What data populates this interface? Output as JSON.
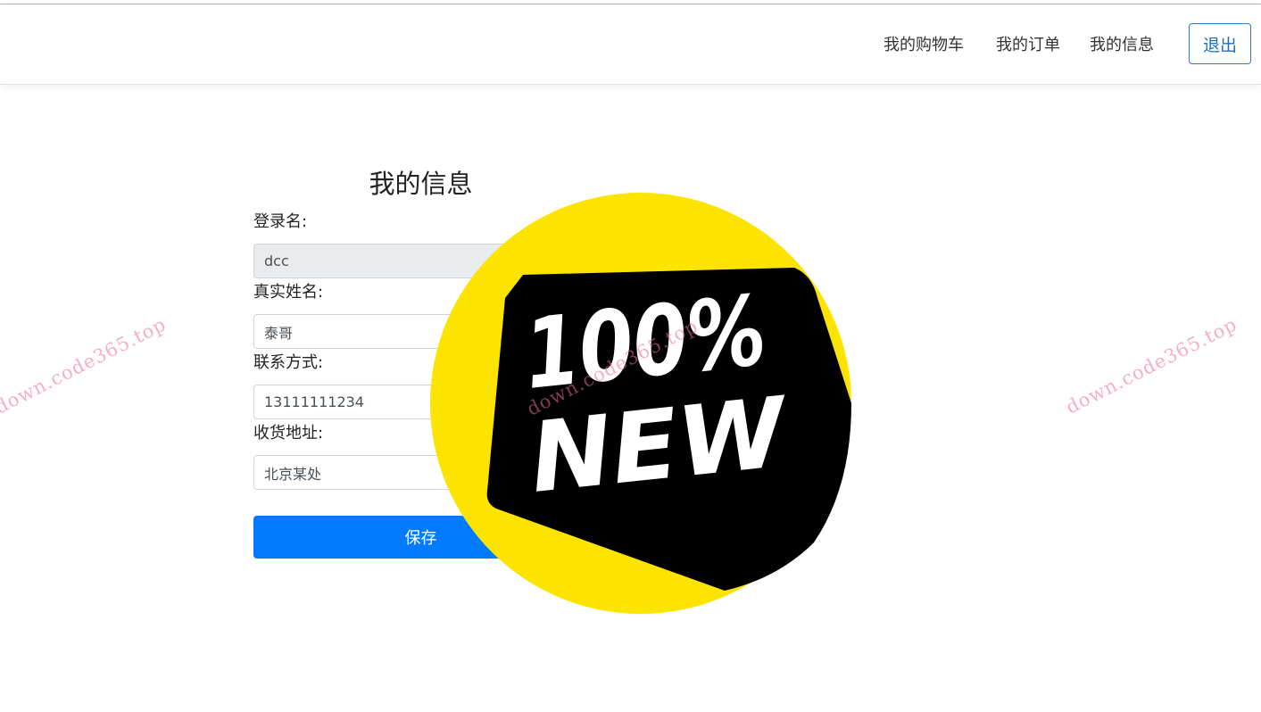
{
  "nav": {
    "cart": "我的购物车",
    "orders": "我的订单",
    "info": "我的信息",
    "logout": "退出"
  },
  "form": {
    "title": "我的信息",
    "fields": [
      {
        "label": "登录名:",
        "value": "dcc",
        "readonly": true
      },
      {
        "label": "真实姓名:",
        "value": "泰哥"
      },
      {
        "label": "联系方式:",
        "value": "13111111234"
      },
      {
        "label": "收货地址:",
        "value": "北京某处"
      }
    ],
    "save_label": "保存"
  },
  "badge": {
    "line1": "100%",
    "line2": "NEW"
  },
  "watermark": "down.code365.top",
  "colors": {
    "primary": "#007bff",
    "badge_yellow": "#fde400",
    "badge_black": "#000000"
  }
}
